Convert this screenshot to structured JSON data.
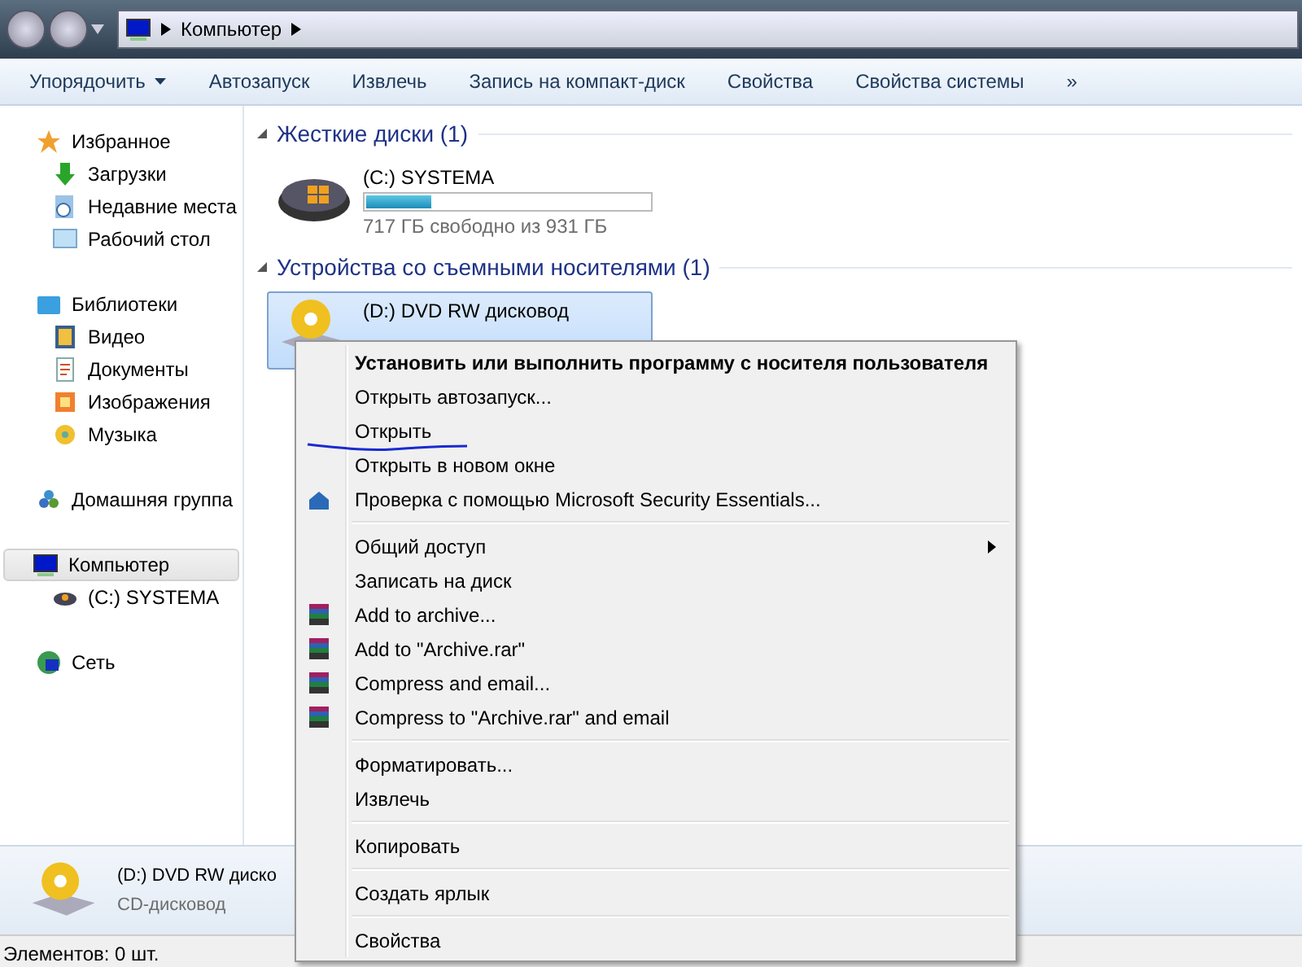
{
  "address_bar": {
    "path": [
      "Компьютер"
    ]
  },
  "toolbar": {
    "buttons": [
      {
        "label": "Упорядочить",
        "dropdown": true
      },
      {
        "label": "Автозапуск",
        "dropdown": false
      },
      {
        "label": "Извлечь",
        "dropdown": false
      },
      {
        "label": "Запись на компакт-диск",
        "dropdown": false
      },
      {
        "label": "Свойства",
        "dropdown": false
      },
      {
        "label": "Свойства системы",
        "dropdown": false
      }
    ],
    "overflow": "»"
  },
  "sidebar": {
    "groups": [
      {
        "label": "Избранное",
        "selected": false,
        "children": [
          {
            "label": "Загрузки",
            "selected": false
          },
          {
            "label": "Недавние места",
            "selected": false
          },
          {
            "label": "Рабочий стол",
            "selected": false
          }
        ]
      },
      {
        "label": "Библиотеки",
        "selected": false,
        "children": [
          {
            "label": "Видео",
            "selected": false
          },
          {
            "label": "Документы",
            "selected": false
          },
          {
            "label": "Изображения",
            "selected": false
          },
          {
            "label": "Музыка",
            "selected": false
          }
        ]
      },
      {
        "label": "Домашняя группа",
        "selected": false
      },
      {
        "label": "Компьютер",
        "selected": true,
        "children": [
          {
            "label": "(C:) SYSTEMA",
            "selected": false
          }
        ]
      },
      {
        "label": "Сеть",
        "selected": false
      }
    ]
  },
  "sections": [
    {
      "title": "Жесткие диски (1)",
      "drives": [
        {
          "kind": "hdd",
          "name": "(C:) SYSTEMA",
          "level": 0.23,
          "free": "717 ГБ свободно из 931 ГБ",
          "selected": false
        }
      ]
    },
    {
      "title": "Устройства со съемными носителями (1)",
      "drives": [
        {
          "kind": "dvd",
          "name": "(D:) DVD RW дисковод",
          "selected": true
        }
      ]
    }
  ],
  "context_menu": [
    {
      "kind": "plain",
      "label": "Установить или выполнить программу с носителя пользователя",
      "bold": true
    },
    {
      "kind": "plain",
      "label": "Открыть автозапуск..."
    },
    {
      "kind": "plain",
      "label": "Открыть",
      "underlined": true
    },
    {
      "kind": "plain",
      "label": "Открыть в новом окне"
    },
    {
      "kind": "scan",
      "label": "Проверка с помощью Microsoft Security Essentials..."
    },
    {
      "kind": "separator"
    },
    {
      "kind": "plain",
      "label": "Общий доступ",
      "submenu": true
    },
    {
      "kind": "plain",
      "label": "Записать на диск"
    },
    {
      "kind": "archive",
      "label": "Add to archive..."
    },
    {
      "kind": "archive",
      "label": "Add to \"Archive.rar\""
    },
    {
      "kind": "archive",
      "label": "Compress and email..."
    },
    {
      "kind": "archive",
      "label": "Compress to \"Archive.rar\" and email"
    },
    {
      "kind": "separator"
    },
    {
      "kind": "plain",
      "label": "Форматировать..."
    },
    {
      "kind": "plain",
      "label": "Извлечь"
    },
    {
      "kind": "separator"
    },
    {
      "kind": "plain",
      "label": "Копировать"
    },
    {
      "kind": "separator"
    },
    {
      "kind": "plain",
      "label": "Создать ярлык"
    },
    {
      "kind": "separator"
    },
    {
      "kind": "plain",
      "label": "Свойства"
    }
  ],
  "details_pane": {
    "name": "(D:) DVD RW диско",
    "type": "CD-дисковод"
  },
  "status_bar": {
    "text": "Элементов: 0 шт."
  }
}
